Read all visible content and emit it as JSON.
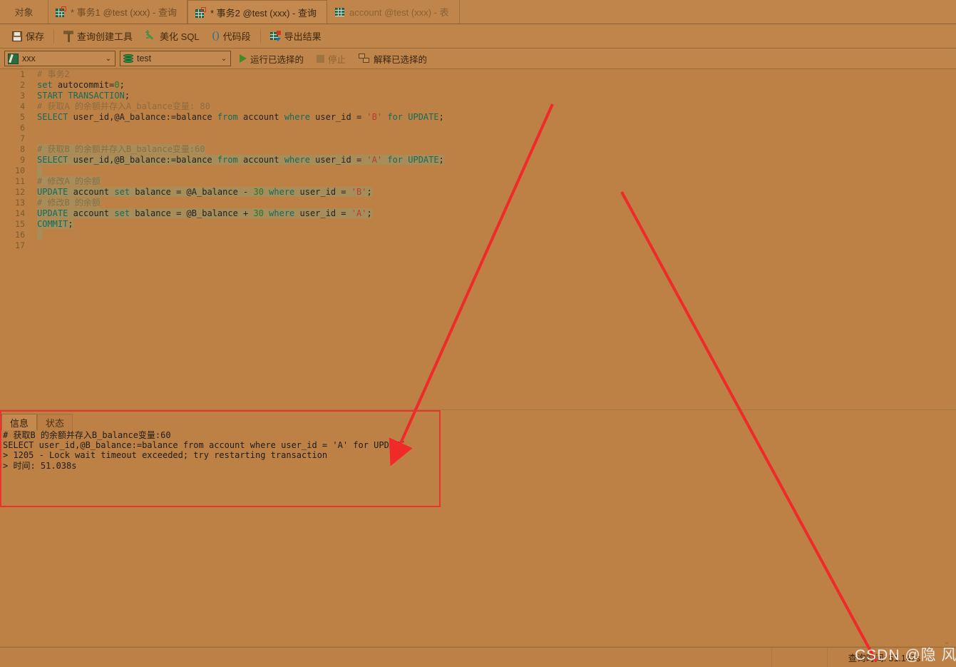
{
  "tabbar": {
    "object_label": "对象",
    "tabs": [
      {
        "label": "* 事务1 @test (xxx) - 查询",
        "icon": "query-grid-icon",
        "state": "inactive"
      },
      {
        "label": "* 事务2 @test (xxx) - 查询",
        "icon": "query-grid-icon",
        "state": "active"
      },
      {
        "label": "account @test (xxx) - 表",
        "icon": "table-grid-icon",
        "state": "dim"
      }
    ]
  },
  "toolbar": {
    "save_label": "保存",
    "query_builder_label": "查询创建工具",
    "beautify_label": "美化 SQL",
    "snippet_paren": "()",
    "snippet_label": "代码段",
    "export_label": "导出结果"
  },
  "toolbar2": {
    "connection_value": "xxx",
    "database_value": "test",
    "run_selected_label": "运行已选择的",
    "stop_label": "停止",
    "explain_selected_label": "解释已选择的",
    "chevron": "⌄"
  },
  "editor": {
    "line_numbers": [
      "1",
      "2",
      "3",
      "4",
      "5",
      "6",
      "7",
      "8",
      "9",
      "10",
      "11",
      "12",
      "13",
      "14",
      "15",
      "16",
      "17"
    ],
    "lines": [
      "# 事务2",
      "set autocommit=0;",
      "START TRANSACTION;",
      "# 获取A 的余额并存入A_balance变量: 80",
      "SELECT user_id,@A_balance:=balance from account where user_id = 'B' for UPDATE;",
      "",
      "",
      "# 获取B 的余额并存入B_balance变量:60",
      "SELECT user_id,@B_balance:=balance from account where user_id = 'A' for UPDATE;",
      "",
      "# 修改A 的余额",
      "UPDATE account set balance = @A_balance - 30 where user_id = 'B';",
      "# 修改B 的余额",
      "UPDATE account set balance = @B_balance + 30 where user_id = 'A';",
      "COMMIT;",
      "",
      ""
    ]
  },
  "result_panel": {
    "tabs": [
      {
        "label": "信息",
        "active": true
      },
      {
        "label": "状态",
        "active": false
      }
    ],
    "output_lines": [
      "# 获取B 的余额并存入B_balance变量:60",
      "SELECT user_id,@B_balance:=balance from account where user_id = 'A' for UPDATE",
      "> 1205 - Lock wait timeout exceeded; try restarting transaction",
      "> 时间: 51.038s"
    ]
  },
  "statusbar": {
    "query_time_label": "查询时间: 51.147s",
    "chevron": "⌄"
  },
  "annotations": {
    "watermark": "CSDN @隐 风",
    "highlight_color": "#e8342a",
    "arrow_color": "#f02a28"
  }
}
